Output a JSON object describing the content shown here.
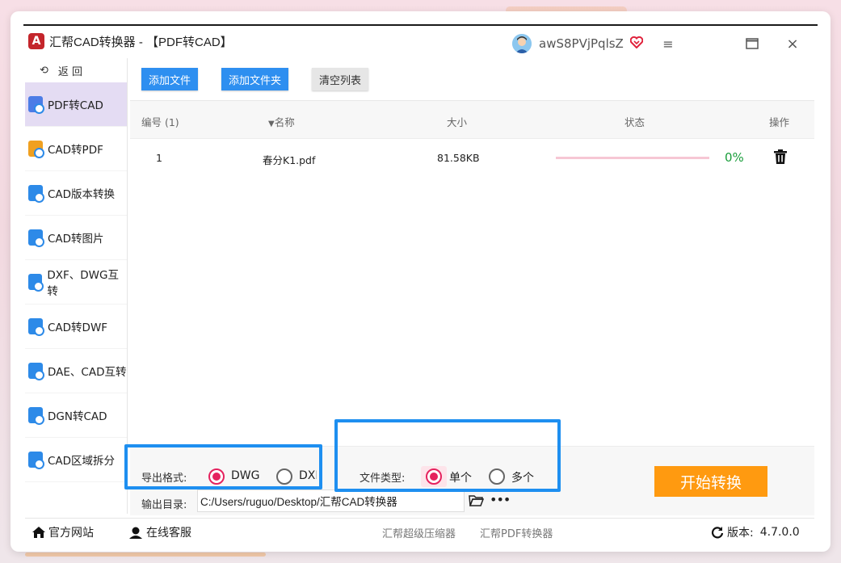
{
  "window": {
    "title": "汇帮CAD转换器 - 【PDF转CAD】",
    "logo_letter": "A",
    "username": "awS8PVjPqlsZ",
    "controls": {
      "menu": "≡",
      "maximize": "☐",
      "close": "×"
    }
  },
  "sidebar": {
    "back_label": "返 回",
    "items": [
      {
        "label": "PDF转CAD",
        "active": true
      },
      {
        "label": "CAD转PDF"
      },
      {
        "label": "CAD版本转换"
      },
      {
        "label": "CAD转图片"
      },
      {
        "label": "DXF、DWG互转"
      },
      {
        "label": "CAD转DWF"
      },
      {
        "label": "DAE、CAD互转"
      },
      {
        "label": "DGN转CAD"
      },
      {
        "label": "CAD区域拆分"
      }
    ]
  },
  "toolbar": {
    "add_file": "添加文件",
    "add_folder": "添加文件夹",
    "clear_list": "清空列表"
  },
  "table": {
    "headers": {
      "index": "编号 (1)",
      "name": "名称",
      "size": "大小",
      "status": "状态",
      "action": "操作"
    },
    "rows": [
      {
        "index": "1",
        "name": "春分K1.pdf",
        "size": "81.58KB",
        "progress": 0,
        "percent": "0%"
      }
    ]
  },
  "options": {
    "format_label": "导出格式:",
    "format_dwg": "DWG",
    "format_dxf": "DXF",
    "format_selected": "DWG",
    "type_label": "文件类型:",
    "type_single": "单个",
    "type_multi": "多个",
    "type_selected": "单个",
    "output_label": "输出目录:",
    "output_path": "C:/Users/ruguo/Desktop/汇帮CAD转换器",
    "start_button": "开始转换"
  },
  "footer": {
    "website": "官方网站",
    "service": "在线客服",
    "link_compressor": "汇帮超级压缩器",
    "link_pdf": "汇帮PDF转换器",
    "version_label": "版本:",
    "version": "4.7.0.0"
  },
  "colors": {
    "accent_blue": "#2e8ff0",
    "start_orange": "#ff9a10",
    "radio_pink": "#e5225e",
    "active_sidebar": "#e4dcf3",
    "progress_green": "#1b9e3c"
  }
}
